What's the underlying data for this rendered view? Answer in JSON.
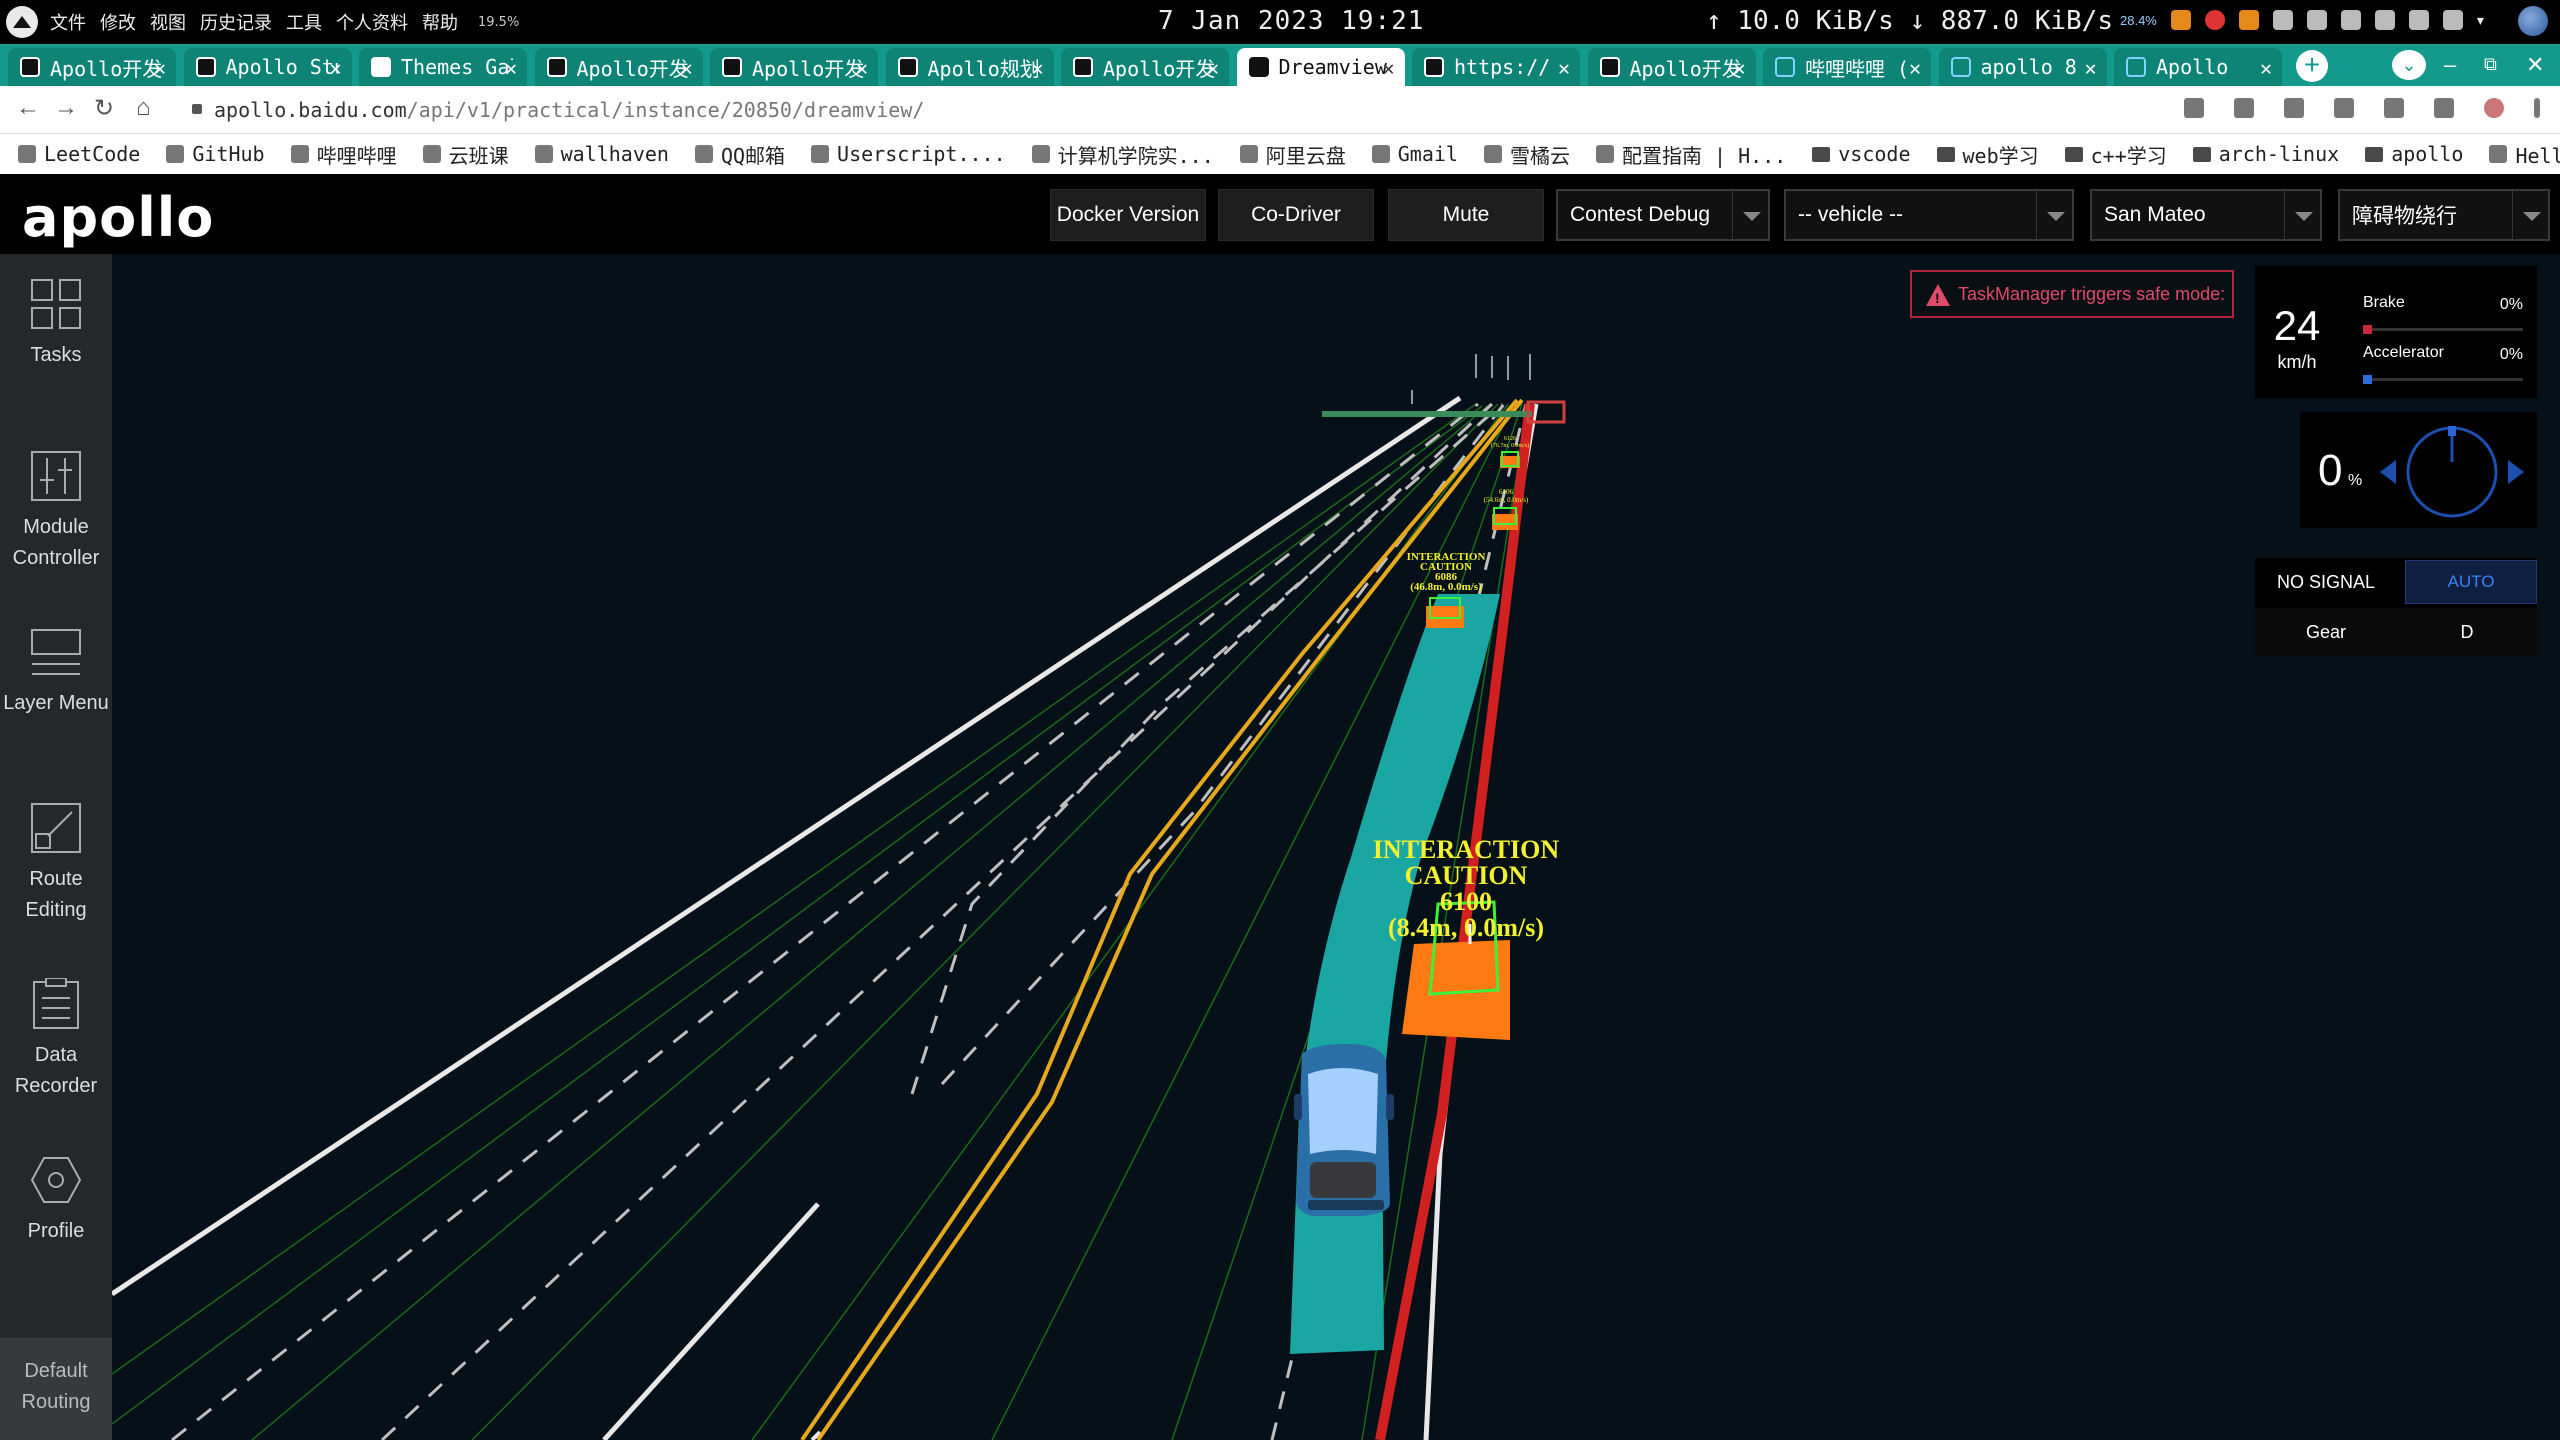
{
  "os": {
    "menus": [
      "文件",
      "修改",
      "视图",
      "历史记录",
      "工具",
      "个人资料",
      "帮助"
    ],
    "cpu": "19.5%",
    "clock": "7 Jan 2023 19:21",
    "net_up": "↑  10.0 KiB/s",
    "net_down": "↓ 887.0 KiB/s",
    "tray_pct": "28.4%"
  },
  "browser": {
    "tabs": [
      {
        "label": "Apollo开发",
        "icon": "apollo",
        "active": false
      },
      {
        "label": "Apollo Studio",
        "icon": "apollo",
        "active": false
      },
      {
        "label": "Themes Gallery",
        "icon": "t",
        "active": false
      },
      {
        "label": "Apollo开发",
        "icon": "apollo",
        "active": false
      },
      {
        "label": "Apollo开发",
        "icon": "apollo",
        "active": false
      },
      {
        "label": "Apollo规划",
        "icon": "apollo",
        "active": false
      },
      {
        "label": "Apollo开发",
        "icon": "apollo",
        "active": false
      },
      {
        "label": "Dreamview",
        "icon": "apollo",
        "active": true
      },
      {
        "label": "https://",
        "icon": "apollo",
        "active": false
      },
      {
        "label": "Apollo开发",
        "icon": "apollo",
        "active": false
      },
      {
        "label": "哔哩哔哩 (",
        "icon": "bili",
        "active": false
      },
      {
        "label": "apollo 8",
        "icon": "bili",
        "active": false
      },
      {
        "label": "Apollo",
        "icon": "bili",
        "active": false
      }
    ],
    "url_host": "apollo.baidu.com",
    "url_path": "/api/v1/practical/instance/20850/dreamview/",
    "bookmarks": [
      {
        "label": "LeetCode",
        "folder": false
      },
      {
        "label": "GitHub",
        "folder": false
      },
      {
        "label": "哔哩哔哩",
        "folder": false
      },
      {
        "label": "云班课",
        "folder": false
      },
      {
        "label": "wallhaven",
        "folder": false
      },
      {
        "label": "QQ邮箱",
        "folder": false
      },
      {
        "label": "Userscript....",
        "folder": false
      },
      {
        "label": "计算机学院实...",
        "folder": false
      },
      {
        "label": "阿里云盘",
        "folder": false
      },
      {
        "label": "Gmail",
        "folder": false
      },
      {
        "label": "雪橘云",
        "folder": false
      },
      {
        "label": "配置指南 | H...",
        "folder": false
      },
      {
        "label": "vscode",
        "folder": true
      },
      {
        "label": "web学习",
        "folder": true
      },
      {
        "label": "c++学习",
        "folder": true
      },
      {
        "label": "arch-linux",
        "folder": true
      },
      {
        "label": "apollo",
        "folder": true
      },
      {
        "label": "Hello 算法",
        "folder": false
      }
    ]
  },
  "header": {
    "logo": "apollo",
    "docker_version": "Docker Version",
    "co_driver": "Co-Driver",
    "mute": "Mute",
    "mode": "Contest Debug",
    "vehicle": "-- vehicle --",
    "map": "San Mateo",
    "scenario": "障碍物绕行"
  },
  "sidebar": {
    "items": [
      {
        "label": "Tasks",
        "icon": "tasks-icon"
      },
      {
        "label": "Module Controller",
        "icon": "module-controller-icon"
      },
      {
        "label": "Layer Menu",
        "icon": "layer-menu-icon"
      },
      {
        "label": "Route Editing",
        "icon": "route-editing-icon"
      },
      {
        "label": "Data Recorder",
        "icon": "data-recorder-icon"
      },
      {
        "label": "Profile",
        "icon": "profile-icon"
      }
    ],
    "default_routing": "Default Routing"
  },
  "hud": {
    "alert": "TaskManager triggers safe mode:",
    "speed": "24",
    "speed_unit": "km/h",
    "brake_label": "Brake",
    "brake_pct": "0%",
    "accel_label": "Accelerator",
    "accel_pct": "0%",
    "steering": "0",
    "steering_unit": "%",
    "signal": "NO SIGNAL",
    "driving_mode": "AUTO",
    "gear_label": "Gear",
    "gear": "D"
  },
  "scene": {
    "obstacles": [
      {
        "line1": "INTERACTION",
        "line2": "CAUTION",
        "id": "6100",
        "info": "(8.4m, 0.0m/s)"
      },
      {
        "line1": "INTERACTION",
        "line2": "CAUTION",
        "id": "6086",
        "info": "(46.8m, 0.0m/s)"
      },
      {
        "id": "6106",
        "info": "(54.6m, 0.0m/s)"
      },
      {
        "id": "6126",
        "info": "(76.7m, 0.0m/s)"
      }
    ]
  },
  "colors": {
    "brand_teal": "#149a8c",
    "alert": "#e04a6a",
    "auto_blue": "#3a82f6",
    "path_teal": "#1aa7a3",
    "obstacle_orange": "#ff7a12",
    "label_yellow": "#f2f230"
  }
}
